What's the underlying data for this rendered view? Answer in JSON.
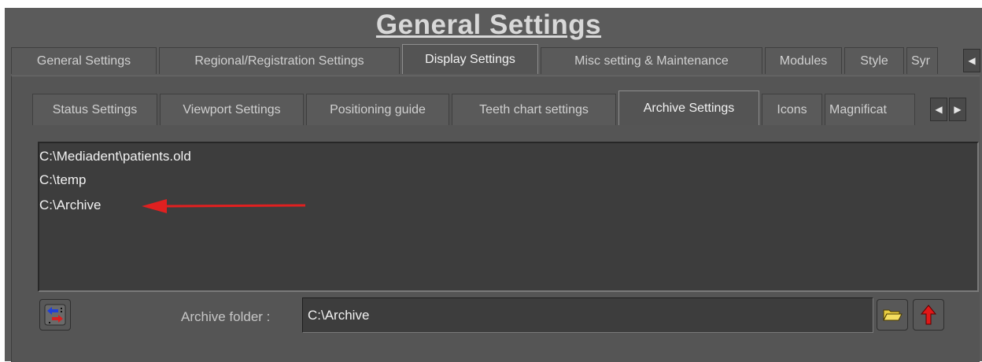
{
  "window": {
    "title": "General Settings"
  },
  "main_tabs": [
    {
      "label": "General Settings"
    },
    {
      "label": "Regional/Registration Settings"
    },
    {
      "label": "Display Settings",
      "active": true
    },
    {
      "label": "Misc setting & Maintenance"
    },
    {
      "label": "Modules"
    },
    {
      "label": "Style"
    },
    {
      "label": "Syr"
    }
  ],
  "sub_tabs": [
    {
      "label": "Status Settings"
    },
    {
      "label": "Viewport Settings"
    },
    {
      "label": "Positioning guide"
    },
    {
      "label": "Teeth chart settings"
    },
    {
      "label": "Archive Settings",
      "active": true
    },
    {
      "label": "Icons"
    },
    {
      "label": "Magnificat"
    }
  ],
  "archive_list": {
    "items": [
      "C:\\Mediadent\\patients.old",
      "C:\\temp",
      "C:\\Archive"
    ]
  },
  "archive_folder": {
    "label": "Archive folder :",
    "value": "C:\\Archive"
  },
  "icons": {
    "swap": "swap-arrows-icon",
    "browse": "folder-open-icon",
    "up": "red-up-arrow-icon",
    "tab_left": "triangle-left-icon",
    "tab_right": "triangle-right-icon",
    "annotation": "red-arrow-annotation"
  },
  "colors": {
    "background": "#5b5b5b",
    "list_bg": "#3d3d3d",
    "annotation_arrow": "#e02020"
  }
}
